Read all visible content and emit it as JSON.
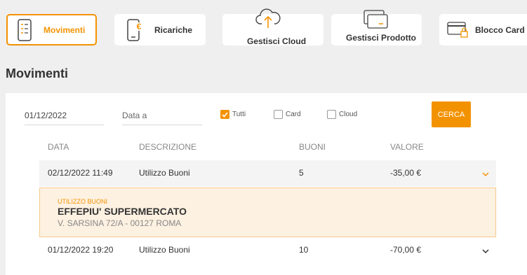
{
  "nav": {
    "movimenti": "Movimenti",
    "ricariche": "Ricariche",
    "gestisci_cloud": "Gestisci Cloud",
    "gestisci_prodotto": "Gestisci Prodotto",
    "blocco_card": "Blocco Card"
  },
  "page_title": "Movimenti",
  "filters": {
    "date_from": "01/12/2022",
    "date_to_placeholder": "Data a",
    "tutti": "Tutti",
    "card": "Card",
    "cloud": "Cloud",
    "tutti_checked": true,
    "card_checked": false,
    "cloud_checked": false,
    "search_label": "CERCA"
  },
  "table": {
    "headers": {
      "data": "DATA",
      "descrizione": "DESCRIZIONE",
      "buoni": "BUONI",
      "valore": "VALORE"
    },
    "rows": [
      {
        "data": "02/12/2022 11:49",
        "descrizione": "Utilizzo Buoni",
        "buoni": "5",
        "valore": "-35,00 €"
      },
      {
        "data": "01/12/2022 19:20",
        "descrizione": "Utilizzo Buoni",
        "buoni": "10",
        "valore": "-70,00 €"
      }
    ],
    "detail": {
      "type": "UTILIZZO BUONI",
      "merchant": "EFFEPIU' SUPERMERCATO",
      "address": "V. SARSINA 72/A - 00127 ROMA"
    }
  },
  "colors": {
    "accent": "#f39200",
    "background": "#efefef",
    "detail_bg": "#fdf1e1"
  }
}
